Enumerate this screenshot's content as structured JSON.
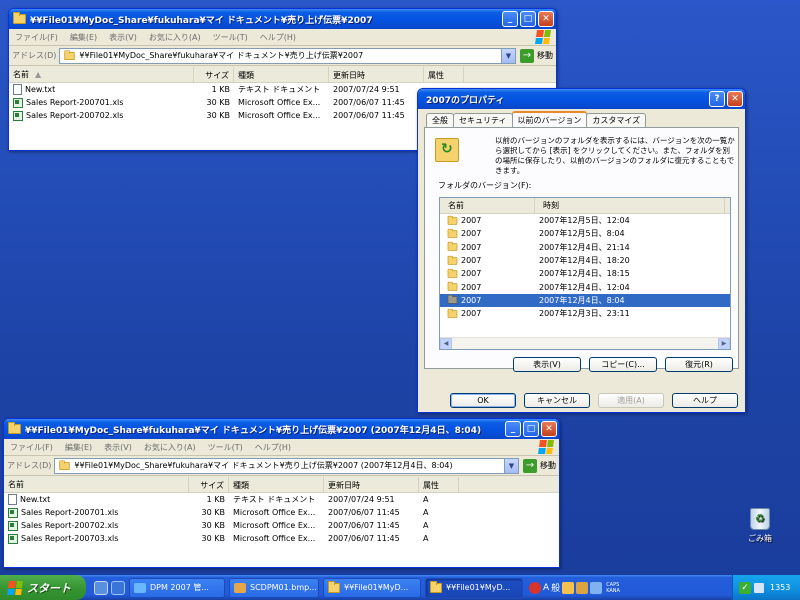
{
  "colors": {
    "titlebar": "#0a5ce4",
    "selection": "#316ac5",
    "desktop": "#1e46a8",
    "taskbar": "#245edb",
    "start": "#379733"
  },
  "window1": {
    "title": "¥¥File01¥MyDoc_Share¥fukuhara¥マイ ドキュメント¥売り上げ伝票¥2007",
    "menu": [
      "ファイル(F)",
      "編集(E)",
      "表示(V)",
      "お気に入り(A)",
      "ツール(T)",
      "ヘルプ(H)"
    ],
    "address_label": "アドレス(D)",
    "address": "¥¥File01¥MyDoc_Share¥fukuhara¥マイ ドキュメント¥売り上げ伝票¥2007",
    "go_label": "移動",
    "columns": [
      "名前",
      "サイズ",
      "種類",
      "更新日時",
      "属性"
    ],
    "rows": [
      {
        "name": "New.txt",
        "size": "1 KB",
        "type": "テキスト ドキュメント",
        "date": "2007/07/24 9:51",
        "attr": "",
        "icon": "text-file-icon"
      },
      {
        "name": "Sales Report-200701.xls",
        "size": "30 KB",
        "type": "Microsoft Office Ex...",
        "date": "2007/06/07 11:45",
        "attr": "",
        "icon": "excel-file-icon"
      },
      {
        "name": "Sales Report-200702.xls",
        "size": "30 KB",
        "type": "Microsoft Office Ex...",
        "date": "2007/06/07 11:45",
        "attr": "",
        "icon": "excel-file-icon"
      }
    ]
  },
  "dialog": {
    "title": "2007のプロパティ",
    "tabs": [
      "全般",
      "セキュリティ",
      "以前のバージョン",
      "カスタマイズ"
    ],
    "description": "以前のバージョンのフォルダを表示するには、バージョンを次の一覧から選択してから [表示] をクリックしてください。また、フォルダを別の場所に保存したり、以前のバージョンのフォルダに復元することもできます。",
    "list_label": "フォルダのバージョン(F):",
    "columns": [
      "名前",
      "時刻"
    ],
    "versions": [
      {
        "name": "2007",
        "time": "2007年12月5日、12:04"
      },
      {
        "name": "2007",
        "time": "2007年12月5日、8:04"
      },
      {
        "name": "2007",
        "time": "2007年12月4日、21:14"
      },
      {
        "name": "2007",
        "time": "2007年12月4日、18:20"
      },
      {
        "name": "2007",
        "time": "2007年12月4日、18:15"
      },
      {
        "name": "2007",
        "time": "2007年12月4日、12:04"
      },
      {
        "name": "2007",
        "time": "2007年12月4日、8:04"
      },
      {
        "name": "2007",
        "time": "2007年12月3日、23:11"
      }
    ],
    "selected_index": 6,
    "view_button": "表示(V)",
    "copy_button": "コピー(C)...",
    "restore_button": "復元(R)",
    "ok_button": "OK",
    "cancel_button": "キャンセル",
    "apply_button": "適用(A)",
    "help_button": "ヘルプ"
  },
  "window2": {
    "title": "¥¥File01¥MyDoc_Share¥fukuhara¥マイ ドキュメント¥売り上げ伝票¥2007 (2007年12月4日、8:04)",
    "menu": [
      "ファイル(F)",
      "編集(E)",
      "表示(V)",
      "お気に入り(A)",
      "ツール(T)",
      "ヘルプ(H)"
    ],
    "address_label": "アドレス(D)",
    "address": "¥¥File01¥MyDoc_Share¥fukuhara¥マイ ドキュメント¥売り上げ伝票¥2007 (2007年12月4日、8:04)",
    "go_label": "移動",
    "columns": [
      "名前",
      "サイズ",
      "種類",
      "更新日時",
      "属性"
    ],
    "rows": [
      {
        "name": "New.txt",
        "size": "1 KB",
        "type": "テキスト ドキュメント",
        "date": "2007/07/24 9:51",
        "attr": "A",
        "icon": "text-file-icon"
      },
      {
        "name": "Sales Report-200701.xls",
        "size": "30 KB",
        "type": "Microsoft Office Ex...",
        "date": "2007/06/07 11:45",
        "attr": "A",
        "icon": "excel-file-icon"
      },
      {
        "name": "Sales Report-200702.xls",
        "size": "30 KB",
        "type": "Microsoft Office Ex...",
        "date": "2007/06/07 11:45",
        "attr": "A",
        "icon": "excel-file-icon"
      },
      {
        "name": "Sales Report-200703.xls",
        "size": "30 KB",
        "type": "Microsoft Office Ex...",
        "date": "2007/06/07 11:45",
        "attr": "A",
        "icon": "excel-file-icon"
      }
    ]
  },
  "desktop": {
    "recycle_bin_label": "ごみ箱"
  },
  "taskbar": {
    "start_label": "スタート",
    "buttons": [
      {
        "label": "DPM 2007 管...",
        "active": false
      },
      {
        "label": "SCDPM01.bmp...",
        "active": false
      },
      {
        "label": "¥¥File01¥MyD...",
        "active": false
      },
      {
        "label": "¥¥File01¥MyD...",
        "active": true
      }
    ],
    "ime_a": "A",
    "ime_mode": "般",
    "caps": "CAPS",
    "kana": "KANA",
    "clock": "1353"
  }
}
